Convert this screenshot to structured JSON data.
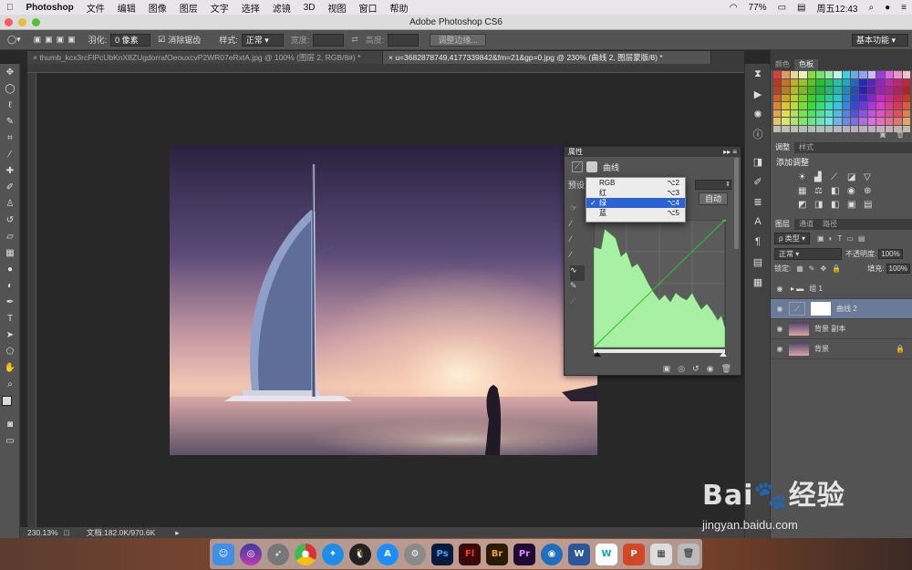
{
  "menubar": {
    "app": "Photoshop",
    "items": [
      "文件",
      "编辑",
      "图像",
      "图层",
      "文字",
      "选择",
      "滤镜",
      "3D",
      "视图",
      "窗口",
      "帮助"
    ],
    "battery": "77%",
    "clock": "周五12:43"
  },
  "window": {
    "title": "Adobe Photoshop CS6"
  },
  "options": {
    "feather_label": "羽化:",
    "feather_value": "0 像素",
    "antialias_label": "消除锯齿",
    "style_label": "样式:",
    "style_value": "正常",
    "width_label": "宽度:",
    "height_label": "高度:",
    "refine_button": "调整边缘...",
    "workspace": "基本功能"
  },
  "tabs": [
    {
      "label": "thumb_kcx3rcFlPcUbKnX8ZUgdorrafOeouxcvP2WR07eRxtA.jpg @ 100% (图层 2, RGB/8#) *",
      "active": false
    },
    {
      "label": "u=3682878749,4177339842&fm=21&gp=0.jpg @ 230% (曲线 2, 图层蒙版/8) *",
      "active": true
    }
  ],
  "status": {
    "zoom": "230.13%",
    "doc": "文档:182.0K/970.6K"
  },
  "properties": {
    "panel_title": "属性",
    "adjust_name": "曲线",
    "preset_label": "预设:",
    "auto_button": "自动",
    "channels": [
      {
        "name": "RGB",
        "shortcut": "⌥2",
        "selected": false
      },
      {
        "name": "红",
        "shortcut": "⌥3",
        "selected": false
      },
      {
        "name": "绿",
        "shortcut": "⌥4",
        "selected": true
      },
      {
        "name": "蓝",
        "shortcut": "⌥5",
        "selected": false
      }
    ]
  },
  "swatches": {
    "tabs": [
      "颜色",
      "色板"
    ],
    "active": "色板"
  },
  "adjustments": {
    "tabs": [
      "调整",
      "样式"
    ],
    "title": "添加调整"
  },
  "layers_panel": {
    "tabs": [
      "图层",
      "通道",
      "路径"
    ],
    "filter_value": "类型",
    "blend_mode": "正常",
    "opacity_label": "不透明度:",
    "opacity_value": "100%",
    "lock_label": "锁定:",
    "fill_label": "填充:",
    "fill_value": "100%",
    "layers": [
      {
        "name": "组 1",
        "type": "group",
        "selected": false
      },
      {
        "name": "曲线 2",
        "type": "adjustment",
        "selected": true
      },
      {
        "name": "背景 副本",
        "type": "image",
        "selected": false
      },
      {
        "name": "背景",
        "type": "image",
        "selected": false,
        "locked": true
      }
    ]
  },
  "watermark": {
    "brand": "Bai",
    "brand2": "经验",
    "url": "jingyan.baidu.com"
  },
  "dock": [
    "Finder",
    "Siri",
    "Launchpad",
    "Chrome",
    "Safari",
    "QQ",
    "App Store",
    "System Preferences",
    "Ps",
    "Fl",
    "Br",
    "Pr",
    "Browser",
    "W",
    "W",
    "P",
    "Preview",
    "Trash"
  ]
}
